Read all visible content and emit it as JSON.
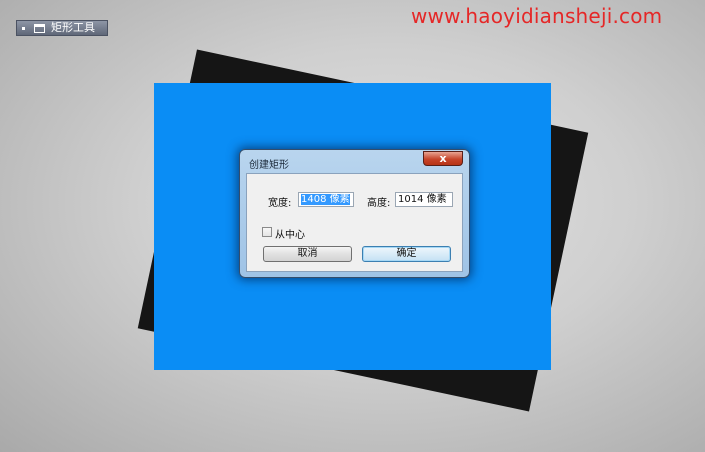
{
  "tool": {
    "label": "矩形工具"
  },
  "watermark": "www.haoyidiansheji.com",
  "dialog": {
    "title": "创建矩形",
    "close_symbol": "x",
    "width_label": "宽度:",
    "width_value": "1408 像素",
    "height_label": "高度:",
    "height_value": "1014 像素",
    "checkbox_label": "从中心",
    "cancel_label": "取消",
    "ok_label": "确定"
  },
  "colors": {
    "canvas_blue": "#0a8df5",
    "shape_black": "#151515",
    "watermark_red": "#e52727"
  }
}
